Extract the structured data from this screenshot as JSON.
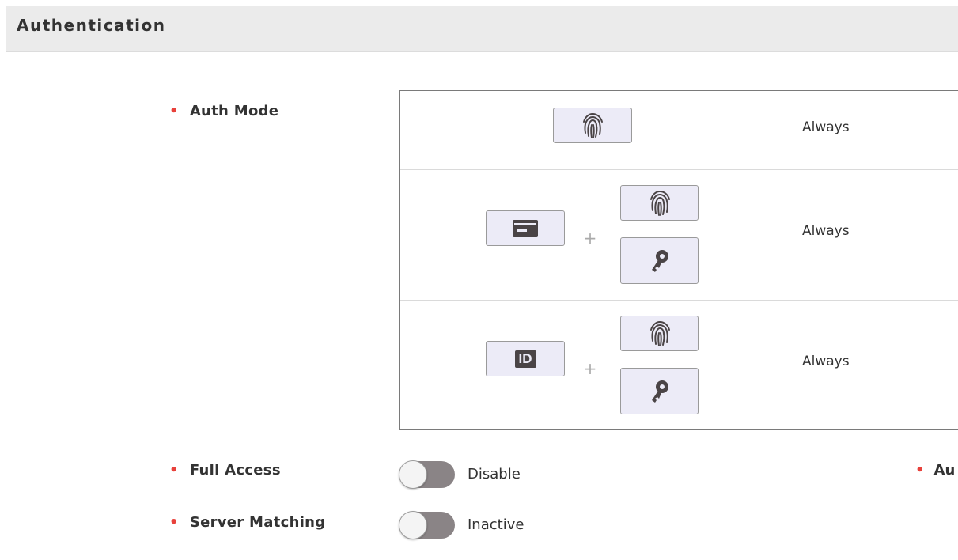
{
  "header": {
    "title": "Authentication"
  },
  "fields": {
    "auth_mode": "Auth Mode",
    "full_access": "Full Access",
    "server_matching": "Server Matching",
    "right_partial": "Au"
  },
  "auth_modes": [
    {
      "icons": [
        "fingerprint-icon"
      ],
      "status": "Always"
    },
    {
      "icons": [
        "card-icon",
        "fingerprint-icon",
        "key-icon"
      ],
      "status": "Always"
    },
    {
      "icons": [
        "id-icon",
        "fingerprint-icon",
        "key-icon"
      ],
      "status": "Always"
    }
  ],
  "plus_sign": "+",
  "id_badge": "ID",
  "toggles": {
    "full_access": {
      "value": "Disable",
      "on": false
    },
    "server_matching": {
      "value": "Inactive",
      "on": false
    }
  },
  "colors": {
    "required_dot": "#e8413b",
    "icon_box_bg": "#ecebf7",
    "icon_fg": "#4a4446",
    "toggle_track": "#8a8486"
  }
}
